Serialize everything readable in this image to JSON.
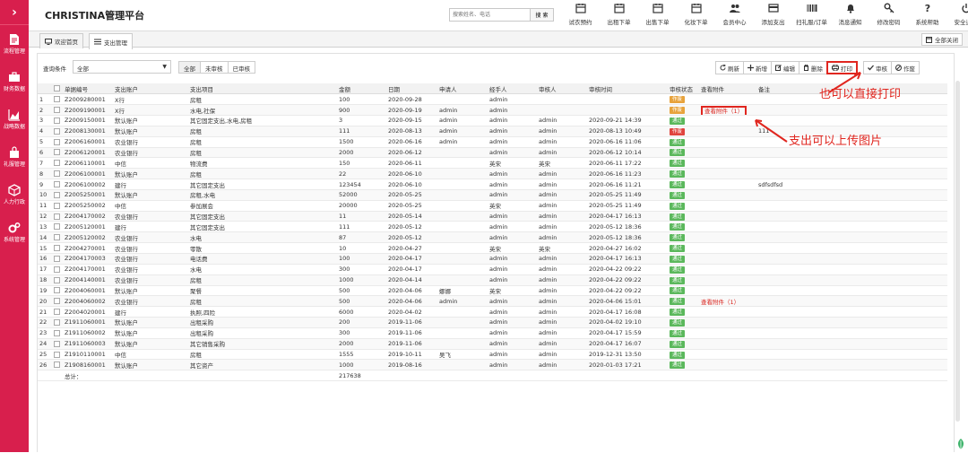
{
  "app": {
    "title": "CHRISTINA管理平台"
  },
  "sidebar": {
    "toggle": "›",
    "items": [
      {
        "label": "流程管理",
        "icon": "document-icon"
      },
      {
        "label": "财务数据",
        "icon": "briefcase-icon"
      },
      {
        "label": "战略数据",
        "icon": "area-chart-icon"
      },
      {
        "label": "礼服管理",
        "icon": "bag-icon"
      },
      {
        "label": "人力行政",
        "icon": "cube-icon"
      },
      {
        "label": "系统管理",
        "icon": "gears-icon"
      }
    ]
  },
  "search": {
    "placeholder": "搜索姓名、电话",
    "button": "搜 索"
  },
  "toolbar": [
    {
      "label": "试衣预约",
      "icon": "calendar-icon"
    },
    {
      "label": "出租下单",
      "icon": "calendar-icon"
    },
    {
      "label": "出售下单",
      "icon": "calendar-icon"
    },
    {
      "label": "化妆下单",
      "icon": "calendar-icon"
    },
    {
      "label": "会员中心",
      "icon": "users-icon"
    },
    {
      "label": "添加支出",
      "icon": "credit-card-icon"
    },
    {
      "label": "扫礼服/订单",
      "icon": "barcode-icon"
    },
    {
      "label": "消息通知",
      "icon": "bell-icon"
    },
    {
      "label": "修改密码",
      "icon": "key-icon"
    },
    {
      "label": "系统帮助",
      "icon": "help-icon"
    },
    {
      "label": "安全退出",
      "icon": "power-icon"
    }
  ],
  "page_tabs": [
    {
      "label": "欢迎首页",
      "icon": "monitor-icon"
    },
    {
      "label": "支出管理",
      "icon": "list-icon",
      "active": true
    }
  ],
  "close_all": "全部关闭",
  "filter": {
    "label": "查询条件",
    "value": "全部",
    "segments": [
      "全部",
      "未审核",
      "已审核"
    ],
    "active_segment": "全部"
  },
  "actions": [
    {
      "label": "刷新",
      "icon": "refresh-icon"
    },
    {
      "label": "新增",
      "icon": "plus-icon"
    },
    {
      "label": "编辑",
      "icon": "edit-icon"
    },
    {
      "label": "删除",
      "icon": "trash-icon"
    },
    {
      "label": "打印",
      "icon": "print-icon"
    },
    {
      "label": "审核",
      "icon": "check-icon"
    },
    {
      "label": "作废",
      "icon": "ban-icon"
    }
  ],
  "status_colors": {
    "作废": "#e8a33c",
    "通过": "#5bb85c",
    "作废red": "#e0443e"
  },
  "table": {
    "columns": [
      "",
      "",
      "单据编号",
      "支出账户",
      "支出项目",
      "金额",
      "日期",
      "申请人",
      "经手人",
      "审核人",
      "审核时间",
      "审核状态",
      "查看附件",
      "备注"
    ],
    "rows": [
      [
        "1",
        "Z2009280001",
        "X行",
        "房租",
        "100",
        "2020-09-28",
        "",
        "admin",
        "",
        "",
        "作废",
        "",
        ""
      ],
      [
        "2",
        "Z2009190001",
        "X行",
        "水电,社保",
        "900",
        "2020-09-19",
        "admin",
        "admin",
        "",
        "",
        "作废",
        "查看附件（1）",
        ""
      ],
      [
        "3",
        "Z2009150001",
        "默认账户",
        "其它固定支出,水电,房租",
        "3",
        "2020-09-15",
        "admin",
        "admin",
        "admin",
        "2020-09-21 14:39",
        "通过",
        "",
        ""
      ],
      [
        "4",
        "Z2008130001",
        "默认账户",
        "房租",
        "111",
        "2020-08-13",
        "admin",
        "admin",
        "admin",
        "2020-08-13 10:49",
        "作废",
        "",
        "111"
      ],
      [
        "5",
        "Z2006160001",
        "农业银行",
        "房租",
        "1500",
        "2020-06-16",
        "admin",
        "admin",
        "admin",
        "2020-06-16 11:06",
        "通过",
        "",
        ""
      ],
      [
        "6",
        "Z2006120001",
        "农业银行",
        "房租",
        "2000",
        "2020-06-12",
        "",
        "admin",
        "admin",
        "2020-06-12 10:14",
        "通过",
        "",
        ""
      ],
      [
        "7",
        "Z2006110001",
        "中信",
        "物流费",
        "150",
        "2020-06-11",
        "",
        "英宋",
        "英宋",
        "2020-06-11 17:22",
        "通过",
        "",
        ""
      ],
      [
        "8",
        "Z2006100001",
        "默认账户",
        "房租",
        "22",
        "2020-06-10",
        "",
        "admin",
        "admin",
        "2020-06-16 11:23",
        "通过",
        "",
        ""
      ],
      [
        "9",
        "Z2006100002",
        "建行",
        "其它固定支出",
        "123454",
        "2020-06-10",
        "",
        "admin",
        "admin",
        "2020-06-16 11:21",
        "通过",
        "",
        "sdfsdfsd"
      ],
      [
        "10",
        "Z2005250001",
        "默认账户",
        "房租,水电",
        "52000",
        "2020-05-25",
        "",
        "admin",
        "admin",
        "2020-05-25 11:49",
        "通过",
        "",
        ""
      ],
      [
        "11",
        "Z2005250002",
        "中信",
        "参加展会",
        "20000",
        "2020-05-25",
        "",
        "英宋",
        "admin",
        "2020-05-25 11:49",
        "通过",
        "",
        ""
      ],
      [
        "12",
        "Z2004170002",
        "农业银行",
        "其它固定支出",
        "11",
        "2020-05-14",
        "",
        "admin",
        "admin",
        "2020-04-17 16:13",
        "通过",
        "",
        ""
      ],
      [
        "13",
        "Z2005120001",
        "建行",
        "其它固定支出",
        "111",
        "2020-05-12",
        "",
        "admin",
        "admin",
        "2020-05-12 18:36",
        "通过",
        "",
        ""
      ],
      [
        "14",
        "Z2005120002",
        "农业银行",
        "水电",
        "87",
        "2020-05-12",
        "",
        "admin",
        "admin",
        "2020-05-12 18:36",
        "通过",
        "",
        ""
      ],
      [
        "15",
        "Z2004270001",
        "农业银行",
        "零散",
        "10",
        "2020-04-27",
        "",
        "英宋",
        "英宋",
        "2020-04-27 16:02",
        "通过",
        "",
        ""
      ],
      [
        "16",
        "Z2004170003",
        "农业银行",
        "电话费",
        "100",
        "2020-04-17",
        "",
        "admin",
        "admin",
        "2020-04-17 16:13",
        "通过",
        "",
        ""
      ],
      [
        "17",
        "Z2004170001",
        "农业银行",
        "水电",
        "300",
        "2020-04-17",
        "",
        "admin",
        "admin",
        "2020-04-22 09:22",
        "通过",
        "",
        ""
      ],
      [
        "18",
        "Z2004140001",
        "农业银行",
        "房租",
        "1000",
        "2020-04-14",
        "",
        "admin",
        "admin",
        "2020-04-22 09:22",
        "通过",
        "",
        ""
      ],
      [
        "19",
        "Z2004060001",
        "默认账户",
        "聚餐",
        "500",
        "2020-04-06",
        "娜娜",
        "英宋",
        "admin",
        "2020-04-22 09:22",
        "通过",
        "",
        ""
      ],
      [
        "20",
        "Z2004060002",
        "农业银行",
        "房租",
        "500",
        "2020-04-06",
        "admin",
        "admin",
        "admin",
        "2020-04-06 15:01",
        "通过",
        "查看附件（1）",
        ""
      ],
      [
        "21",
        "Z2004020001",
        "建行",
        "执照,四险",
        "6000",
        "2020-04-02",
        "",
        "admin",
        "admin",
        "2020-04-17 16:08",
        "通过",
        "",
        ""
      ],
      [
        "22",
        "Z1911060001",
        "默认账户",
        "出租采购",
        "200",
        "2019-11-06",
        "",
        "admin",
        "admin",
        "2020-04-02 19:10",
        "通过",
        "",
        ""
      ],
      [
        "23",
        "Z1911060002",
        "默认账户",
        "出租采购",
        "300",
        "2019-11-06",
        "",
        "admin",
        "admin",
        "2020-04-17 15:59",
        "通过",
        "",
        ""
      ],
      [
        "24",
        "Z1911060003",
        "默认账户",
        "其它销售采购",
        "2000",
        "2019-11-06",
        "",
        "admin",
        "admin",
        "2020-04-17 16:07",
        "通过",
        "",
        ""
      ],
      [
        "25",
        "Z1910110001",
        "中信",
        "房租",
        "1555",
        "2019-10-11",
        "吴飞",
        "admin",
        "admin",
        "2019-12-31 13:50",
        "通过",
        "",
        ""
      ],
      [
        "26",
        "Z1908160001",
        "默认账户",
        "其它资产",
        "1000",
        "2019-08-16",
        "",
        "admin",
        "admin",
        "2020-01-03 17:21",
        "通过",
        "",
        ""
      ]
    ],
    "total_label": "总计：",
    "total_amount": "217638"
  },
  "annotations": {
    "print": "也可以直接打印",
    "upload": "支出可以上传图片"
  }
}
